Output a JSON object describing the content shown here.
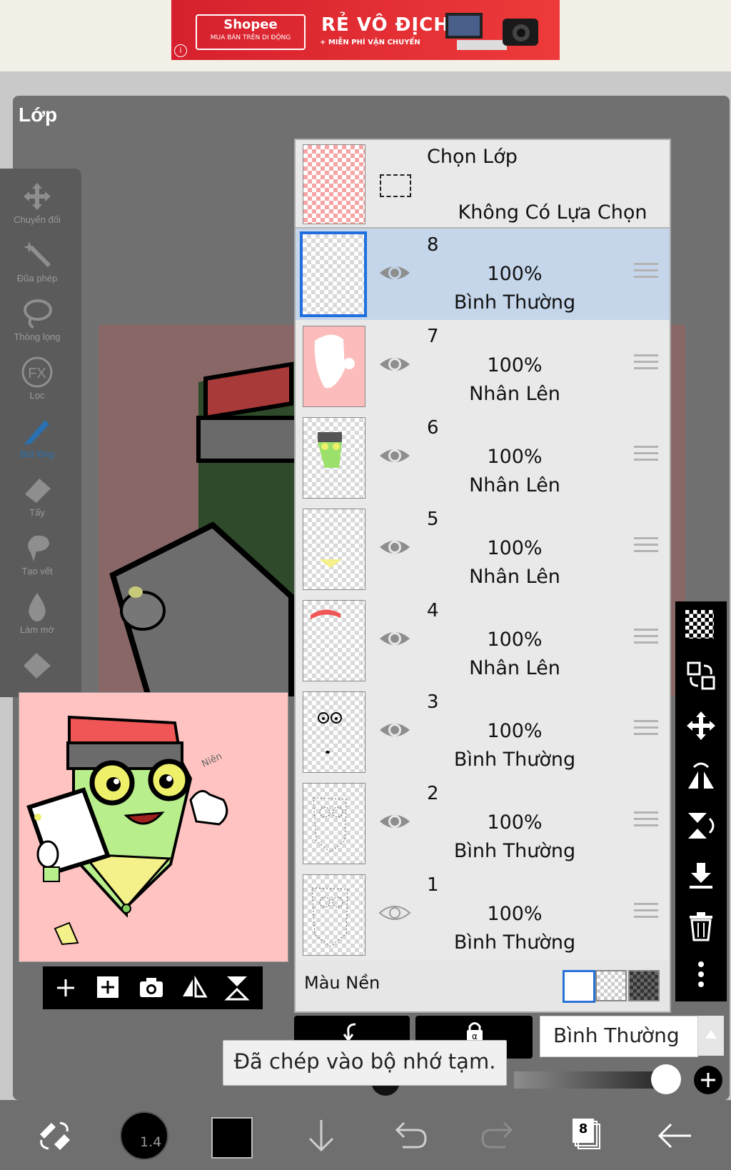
{
  "ad": {
    "brand": "Shopee",
    "brand_sub": "MUA BÁN TRÊN DI ĐỘNG",
    "headline": "RẺ VÔ ĐỊCH",
    "sub": "+ MIỄN PHÍ VẬN CHUYỂN",
    "color": "#d6202d"
  },
  "panel": {
    "title": "Lớp"
  },
  "tools": [
    {
      "label": "Chuyển đổi",
      "icon": "move-icon"
    },
    {
      "label": "Đũa phép",
      "icon": "magic-wand-icon"
    },
    {
      "label": "Thòng lọng",
      "icon": "lasso-icon"
    },
    {
      "label": "Lọc",
      "icon": "fx-icon"
    },
    {
      "label": "Bút lông",
      "icon": "brush-icon",
      "active": true
    },
    {
      "label": "Tẩy",
      "icon": "eraser-icon"
    },
    {
      "label": "Tạo vết",
      "icon": "smudge-icon"
    },
    {
      "label": "Làm mờ",
      "icon": "blur-icon"
    },
    {
      "label": "",
      "icon": "fill-icon"
    }
  ],
  "selection": {
    "title": "Chọn Lớp",
    "status": "Không Có Lựa Chọn"
  },
  "layers": [
    {
      "name": "8",
      "opacity": "100%",
      "mode": "Bình Thường",
      "selected": true
    },
    {
      "name": "7",
      "opacity": "100%",
      "mode": "Nhân Lên"
    },
    {
      "name": "6",
      "opacity": "100%",
      "mode": "Nhân Lên"
    },
    {
      "name": "5",
      "opacity": "100%",
      "mode": "Nhân Lên"
    },
    {
      "name": "4",
      "opacity": "100%",
      "mode": "Nhân Lên"
    },
    {
      "name": "3",
      "opacity": "100%",
      "mode": "Bình Thường"
    },
    {
      "name": "2",
      "opacity": "100%",
      "mode": "Bình Thường"
    },
    {
      "name": "1",
      "opacity": "100%",
      "mode": "Bình Thường",
      "hidden": true
    }
  ],
  "background": {
    "label": "Màu Nền"
  },
  "blend": {
    "mode": "Bình Thường"
  },
  "toast": {
    "text": "Đã chép vào bộ nhớ tạm."
  },
  "bottom": {
    "brush_size": "1.4",
    "layer_count": "8",
    "color": "#000000"
  },
  "colors": {
    "selected_row": "#c5d6ea",
    "accent": "#1f6fe0",
    "preview_bg": "#ffc3c2"
  }
}
